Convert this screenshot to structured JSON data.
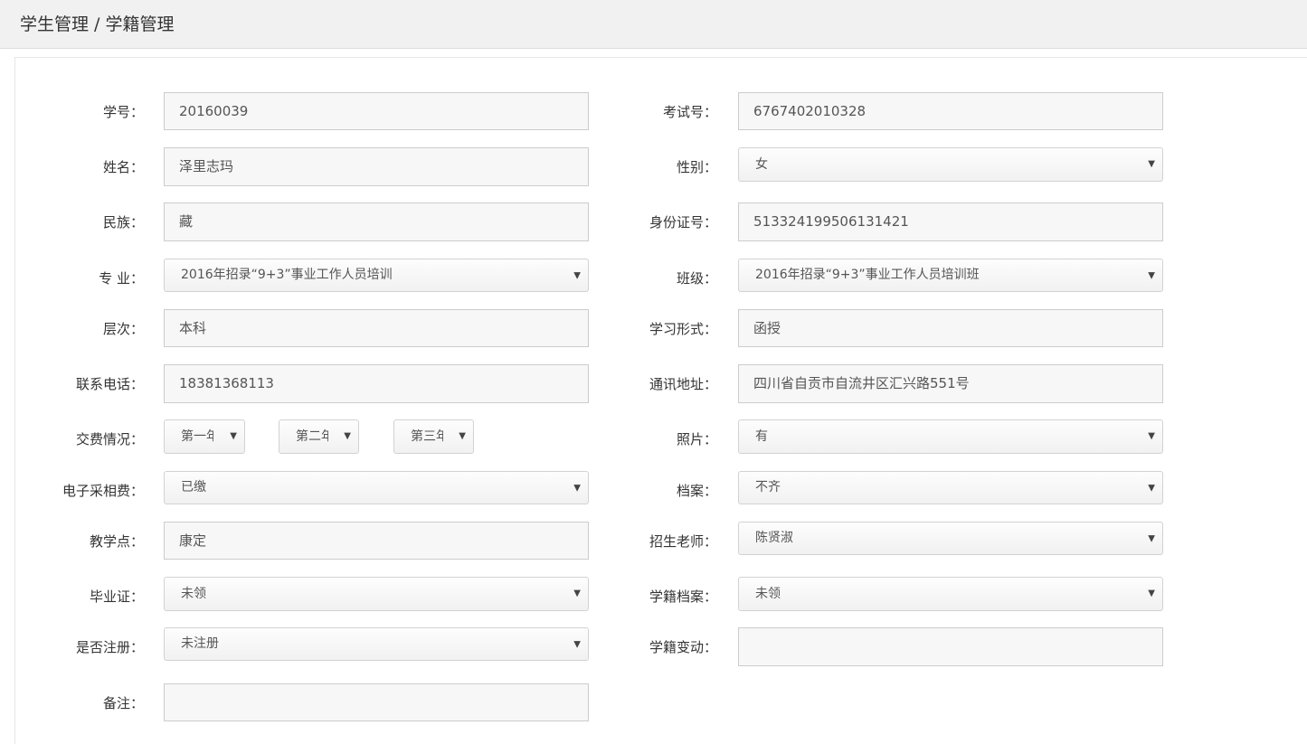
{
  "breadcrumb": "学生管理 / 学籍管理",
  "form": {
    "student_no": {
      "label": "学号：",
      "value": "20160039"
    },
    "exam_no": {
      "label": "考试号：",
      "value": "6767402010328"
    },
    "name": {
      "label": "姓名：",
      "value": "泽里志玛"
    },
    "gender": {
      "label": "性别：",
      "value": "女"
    },
    "ethnicity": {
      "label": "民族：",
      "value": "藏"
    },
    "id_no": {
      "label": "身份证号：",
      "value": "513324199506131421"
    },
    "major": {
      "label": "专 业：",
      "value": "2016年招录“9+3”事业工作人员培训"
    },
    "class": {
      "label": "班级：",
      "value": "2016年招录“9+3”事业工作人员培训班"
    },
    "level": {
      "label": "层次：",
      "value": "本科"
    },
    "study_form": {
      "label": "学习形式：",
      "value": "函授"
    },
    "phone": {
      "label": "联系电话：",
      "value": "18381368113"
    },
    "address": {
      "label": "通讯地址：",
      "value": "四川省自贡市自流井区汇兴路551号"
    },
    "fees": {
      "label": "交费情况：",
      "year1": "第一年",
      "year2": "第二年",
      "year3": "第三年"
    },
    "photo": {
      "label": "照片：",
      "value": "有"
    },
    "photo_fee": {
      "label": "电子采相费：",
      "value": "已缴"
    },
    "archive": {
      "label": "档案：",
      "value": "不齐"
    },
    "teaching_site": {
      "label": "教学点：",
      "value": "康定"
    },
    "recruiter": {
      "label": "招生老师：",
      "value": "陈贤淑"
    },
    "diploma": {
      "label": "毕业证：",
      "value": "未领"
    },
    "status_archive": {
      "label": "学籍档案：",
      "value": "未领"
    },
    "registered": {
      "label": "是否注册：",
      "value": "未注册"
    },
    "status_change": {
      "label": "学籍变动：",
      "value": ""
    },
    "remarks": {
      "label": "备注：",
      "value": ""
    }
  }
}
